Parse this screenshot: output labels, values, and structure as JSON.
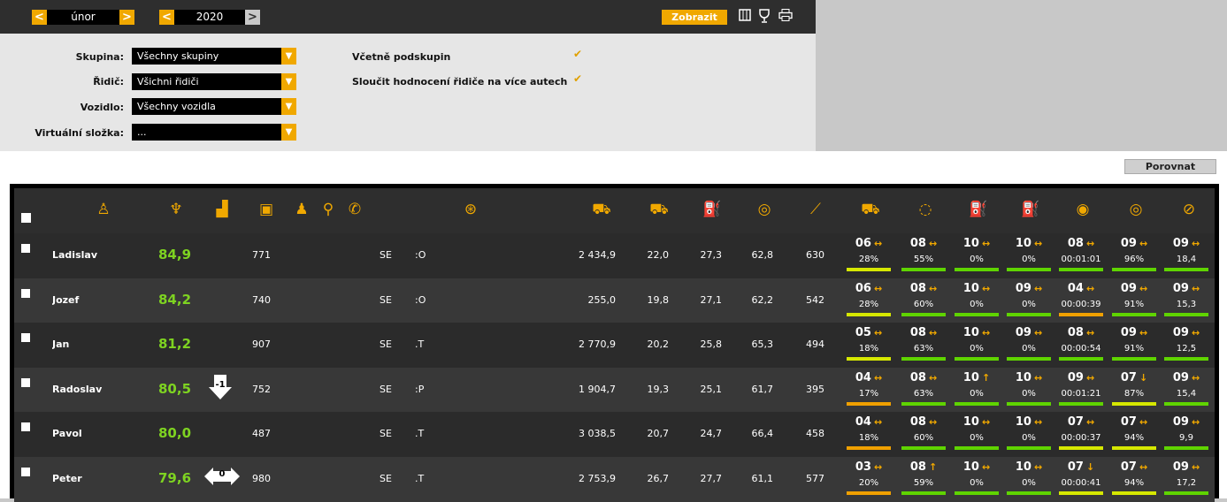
{
  "toolbar": {
    "month": "únor",
    "year": "2020",
    "prev_label": "<",
    "next_label": ">",
    "zobrazit_label": "Zobrazit"
  },
  "filters": {
    "skupina_label": "Skupina:",
    "skupina_value": "Všechny skupiny",
    "ridic_label": "Řidič:",
    "ridic_value": "Všichni řidiči",
    "vozidlo_label": "Vozidlo:",
    "vozidlo_value": "Všechny vozidla",
    "virtualni_label": "Virtuální složka:",
    "virtualni_value": "...",
    "vcetne_label": "Včetně podskupin",
    "vcetne_checked": true,
    "sloucit_label": "Sloučit hodnocení řidiče na více autech",
    "sloucit_checked": true
  },
  "porovnat_label": "Porovnat",
  "colors": {
    "accent": "#f0a800",
    "score": "#7ed321",
    "bar_green": "#5fd400",
    "bar_yellow": "#d6e800",
    "bar_orange": "#f0a000"
  },
  "header_icons": [
    "driver-icon",
    "trophy-icon",
    "rank-chart-icon",
    "id-card-icon",
    "group-icon",
    "tree-icon",
    "phone-icon",
    "steering-wheel-icon",
    "truck-distance-icon",
    "truck-icon",
    "fuel-icon",
    "speed-gauge-icon",
    "slope-icon",
    "tow-truck-icon",
    "coins-icon",
    "fuel-can-icon",
    "fuel-refill-icon",
    "eye-icon",
    "brake-icon",
    "speedometer-icon"
  ],
  "rows": [
    {
      "name": "Ladislav",
      "score": "84,9",
      "rank_change": "",
      "id": "771",
      "col_a": "SE",
      "col_b": ":O",
      "distance": "2 434,9",
      "v1": "22,0",
      "v2": "27,3",
      "v3": "62,8",
      "v4": "630",
      "evals": [
        {
          "grade": "06",
          "trend": "↔",
          "value": "28%",
          "bar": "bar_yellow"
        },
        {
          "grade": "08",
          "trend": "↔",
          "value": "55%",
          "bar": "bar_green"
        },
        {
          "grade": "10",
          "trend": "↔",
          "value": "0%",
          "bar": "bar_green"
        },
        {
          "grade": "10",
          "trend": "↔",
          "value": "0%",
          "bar": "bar_green"
        },
        {
          "grade": "08",
          "trend": "↔",
          "value": "00:01:01",
          "bar": "bar_green"
        },
        {
          "grade": "09",
          "trend": "↔",
          "value": "96%",
          "bar": "bar_green"
        },
        {
          "grade": "09",
          "trend": "↔",
          "value": "18,4",
          "bar": "bar_green"
        }
      ]
    },
    {
      "name": "Jozef",
      "score": "84,2",
      "rank_change": "",
      "id": "740",
      "col_a": "SE",
      "col_b": ":O",
      "distance": "255,0",
      "v1": "19,8",
      "v2": "27,1",
      "v3": "62,2",
      "v4": "542",
      "evals": [
        {
          "grade": "06",
          "trend": "↔",
          "value": "28%",
          "bar": "bar_yellow"
        },
        {
          "grade": "08",
          "trend": "↔",
          "value": "60%",
          "bar": "bar_green"
        },
        {
          "grade": "10",
          "trend": "↔",
          "value": "0%",
          "bar": "bar_green"
        },
        {
          "grade": "09",
          "trend": "↔",
          "value": "0%",
          "bar": "bar_green"
        },
        {
          "grade": "04",
          "trend": "↔",
          "value": "00:00:39",
          "bar": "bar_orange"
        },
        {
          "grade": "09",
          "trend": "↔",
          "value": "91%",
          "bar": "bar_green"
        },
        {
          "grade": "09",
          "trend": "↔",
          "value": "15,3",
          "bar": "bar_green"
        }
      ]
    },
    {
      "name": "Jan",
      "score": "81,2",
      "rank_change": "",
      "id": "907",
      "col_a": "SE",
      "col_b": ".T",
      "distance": "2 770,9",
      "v1": "20,2",
      "v2": "25,8",
      "v3": "65,3",
      "v4": "494",
      "evals": [
        {
          "grade": "05",
          "trend": "↔",
          "value": "18%",
          "bar": "bar_yellow"
        },
        {
          "grade": "08",
          "trend": "↔",
          "value": "63%",
          "bar": "bar_green"
        },
        {
          "grade": "10",
          "trend": "↔",
          "value": "0%",
          "bar": "bar_green"
        },
        {
          "grade": "09",
          "trend": "↔",
          "value": "0%",
          "bar": "bar_green"
        },
        {
          "grade": "08",
          "trend": "↔",
          "value": "00:00:54",
          "bar": "bar_green"
        },
        {
          "grade": "09",
          "trend": "↔",
          "value": "91%",
          "bar": "bar_green"
        },
        {
          "grade": "09",
          "trend": "↔",
          "value": "12,5",
          "bar": "bar_green"
        }
      ]
    },
    {
      "name": "Radoslav",
      "score": "80,5",
      "rank_change": "-1",
      "id": "752",
      "col_a": "SE",
      "col_b": ":P",
      "distance": "1 904,7",
      "v1": "19,3",
      "v2": "25,1",
      "v3": "61,7",
      "v4": "395",
      "evals": [
        {
          "grade": "04",
          "trend": "↔",
          "value": "17%",
          "bar": "bar_orange"
        },
        {
          "grade": "08",
          "trend": "↔",
          "value": "63%",
          "bar": "bar_green"
        },
        {
          "grade": "10",
          "trend": "↑",
          "value": "0%",
          "bar": "bar_green"
        },
        {
          "grade": "10",
          "trend": "↔",
          "value": "0%",
          "bar": "bar_green"
        },
        {
          "grade": "09",
          "trend": "↔",
          "value": "00:01:21",
          "bar": "bar_green"
        },
        {
          "grade": "07",
          "trend": "↓",
          "value": "87%",
          "bar": "bar_yellow"
        },
        {
          "grade": "09",
          "trend": "↔",
          "value": "15,4",
          "bar": "bar_green"
        }
      ]
    },
    {
      "name": "Pavol",
      "score": "80,0",
      "rank_change": "",
      "id": "487",
      "col_a": "SE",
      "col_b": ".T",
      "distance": "3 038,5",
      "v1": "20,7",
      "v2": "24,7",
      "v3": "66,4",
      "v4": "458",
      "evals": [
        {
          "grade": "04",
          "trend": "↔",
          "value": "18%",
          "bar": "bar_orange"
        },
        {
          "grade": "08",
          "trend": "↔",
          "value": "60%",
          "bar": "bar_green"
        },
        {
          "grade": "10",
          "trend": "↔",
          "value": "0%",
          "bar": "bar_green"
        },
        {
          "grade": "10",
          "trend": "↔",
          "value": "0%",
          "bar": "bar_green"
        },
        {
          "grade": "07",
          "trend": "↔",
          "value": "00:00:37",
          "bar": "bar_yellow"
        },
        {
          "grade": "07",
          "trend": "↔",
          "value": "94%",
          "bar": "bar_yellow"
        },
        {
          "grade": "09",
          "trend": "↔",
          "value": "9,9",
          "bar": "bar_green"
        }
      ]
    },
    {
      "name": "Peter",
      "score": "79,6",
      "rank_change": "0",
      "id": "980",
      "col_a": "SE",
      "col_b": ".T",
      "distance": "2 753,9",
      "v1": "26,7",
      "v2": "27,7",
      "v3": "61,1",
      "v4": "577",
      "evals": [
        {
          "grade": "03",
          "trend": "↔",
          "value": "20%",
          "bar": "bar_orange"
        },
        {
          "grade": "08",
          "trend": "↑",
          "value": "59%",
          "bar": "bar_green"
        },
        {
          "grade": "10",
          "trend": "↔",
          "value": "0%",
          "bar": "bar_green"
        },
        {
          "grade": "10",
          "trend": "↔",
          "value": "0%",
          "bar": "bar_green"
        },
        {
          "grade": "07",
          "trend": "↓",
          "value": "00:00:41",
          "bar": "bar_yellow"
        },
        {
          "grade": "07",
          "trend": "↔",
          "value": "94%",
          "bar": "bar_yellow"
        },
        {
          "grade": "09",
          "trend": "↔",
          "value": "17,2",
          "bar": "bar_green"
        }
      ]
    }
  ]
}
